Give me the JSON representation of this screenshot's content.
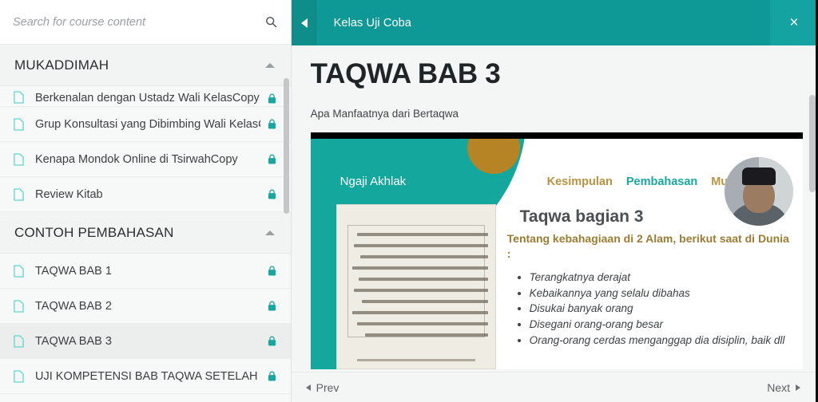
{
  "colors": {
    "teal": "#14a3a0",
    "teal_dark": "#0f8d8b",
    "teal_slide": "#14a79d",
    "gold": "#b78425",
    "gold_text": "#b9933f",
    "sidebar_bg": "#f7f8f8",
    "active_row": "#eceeee"
  },
  "sidebar": {
    "search": {
      "placeholder": "Search for course content",
      "value": "",
      "icon": "search-icon"
    },
    "sections": [
      {
        "title": "MUKADDIMAH",
        "collapse_icon": "caret-up-icon",
        "items": [
          {
            "label": "Berkenalan dengan Ustadz Wali KelasCopy",
            "icon": "document-icon",
            "status_icon": "lock-icon",
            "clipped": true,
            "active": false
          },
          {
            "label": "Grup Konsultasi yang Dibimbing Wali KelasCopy",
            "icon": "document-icon",
            "status_icon": "lock-icon",
            "clipped": false,
            "active": false
          },
          {
            "label": "Kenapa Mondok Online di TsirwahCopy",
            "icon": "document-icon",
            "status_icon": "lock-icon",
            "clipped": false,
            "active": false
          },
          {
            "label": "Review Kitab",
            "icon": "document-icon",
            "status_icon": "lock-icon",
            "clipped": false,
            "active": false
          }
        ]
      },
      {
        "title": "CONTOH PEMBAHASAN",
        "collapse_icon": "caret-up-icon",
        "items": [
          {
            "label": "TAQWA BAB 1",
            "icon": "document-icon",
            "status_icon": "lock-icon",
            "clipped": false,
            "active": false
          },
          {
            "label": "TAQWA BAB 2",
            "icon": "document-icon",
            "status_icon": "lock-icon",
            "clipped": false,
            "active": false
          },
          {
            "label": "TAQWA BAB 3",
            "icon": "document-icon",
            "status_icon": "lock-icon",
            "clipped": false,
            "active": true
          },
          {
            "label": "UJI KOMPETENSI BAB TAQWA SETELAH BELAJAR",
            "icon": "document-icon",
            "status_icon": "lock-icon",
            "clipped": false,
            "active": false
          }
        ]
      }
    ]
  },
  "header": {
    "back_icon": "back-arrow-icon",
    "title": "Kelas Uji Coba",
    "close_label": "×"
  },
  "main": {
    "page_title": "TAQWA BAB 3",
    "page_subtitle": "Apa Manfaatnya dari Bertaqwa"
  },
  "slide": {
    "brand_label": "Ngaji Akhlak",
    "nav": [
      {
        "label": "Kesimpulan",
        "color": "#b9933f"
      },
      {
        "label": "Pembahasan",
        "color": "#18a9a2"
      },
      {
        "label": "Mukad",
        "color": "#b9933f"
      }
    ],
    "heading": "Taqwa bagian 3",
    "lead": "Tentang kebahagiaan di 2 Alam, berikut saat di Dunia :",
    "bullets": [
      "Terangkatnya derajat",
      "Kebaikannya yang selalu dibahas",
      "Disukai banyak orang",
      "Disegani orang-orang besar",
      "Orang-orang cerdas menganggap dia disiplin, baik dll"
    ],
    "presenter_avatar": "presenter-avatar"
  },
  "pager": {
    "prev_label": "Prev",
    "next_label": "Next"
  }
}
